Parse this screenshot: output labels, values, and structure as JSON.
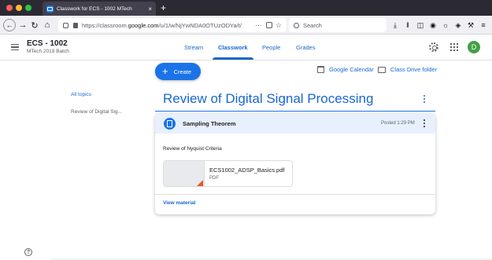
{
  "browser": {
    "tab_title": "Classwork for ECS - 1002 MTech",
    "tab_close": "×",
    "new_tab": "+",
    "url_prefix": "https://classroom.",
    "url_domain": "google.com",
    "url_path": "/u/1/w/NjYwNDA0OTUzODYa/t/",
    "url_more": "···",
    "search_placeholder": "Search"
  },
  "app": {
    "class_name": "ECS - 1002",
    "batch": "MTech 2019 Batch",
    "tabs": [
      "Stream",
      "Classwork",
      "People",
      "Grades"
    ],
    "active_tab": "Classwork",
    "avatar_letter": "D"
  },
  "toolbar": {
    "create_label": "Create",
    "calendar_label": "Google Calendar",
    "drive_label": "Class Drive folder"
  },
  "sidebar": {
    "all_topics": "All topics",
    "topics": [
      "Review of Digital Sig..."
    ]
  },
  "topic": {
    "title": "Review of Digital Signal Processing",
    "assignment": {
      "title": "Sampling Theorem",
      "posted": "Posted 1:29 PM",
      "description": "Review of Nyquist Criteria",
      "attachment": {
        "name": "ECS1002_ADSP_Basics.pdf",
        "type": "PDF"
      },
      "view_link": "View material"
    }
  },
  "help_icon": "?",
  "colors": {
    "accent": "#1a73e8",
    "link": "#1967d2",
    "header_tint": "#e8f0fe",
    "avatar": "#43a047"
  }
}
